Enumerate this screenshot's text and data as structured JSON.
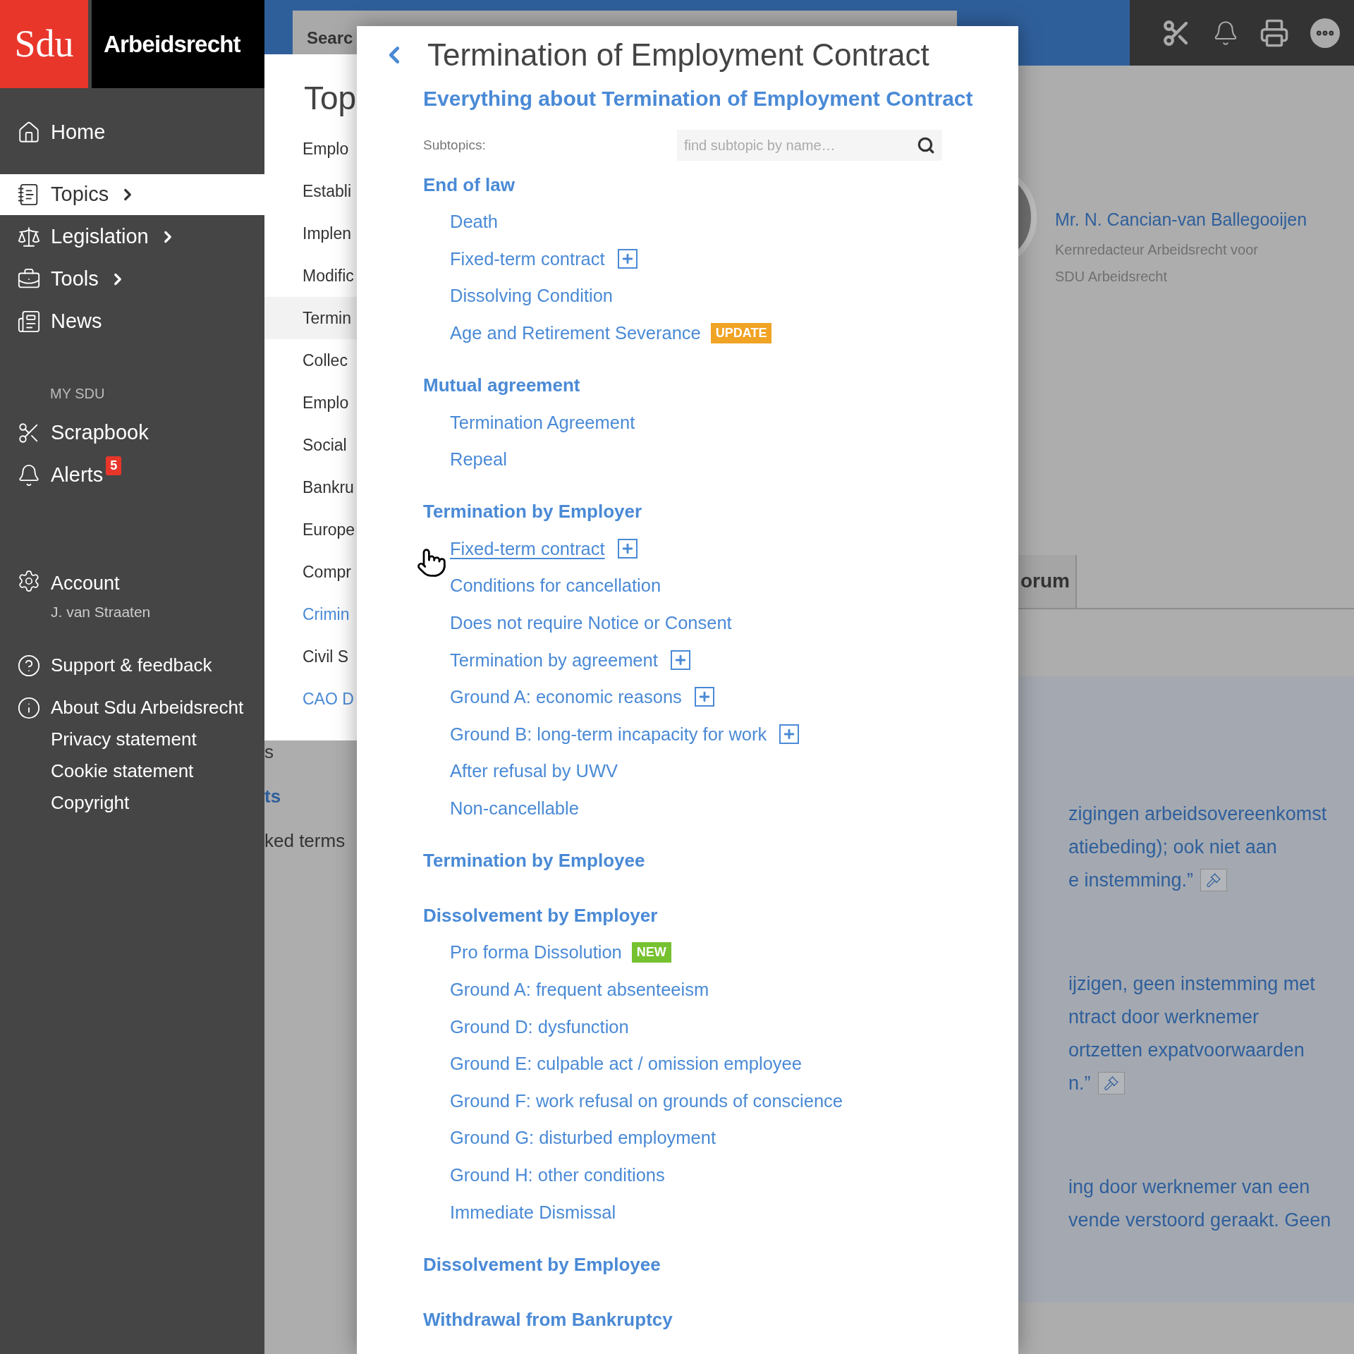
{
  "brand": {
    "logo": "Sdu",
    "title": "Arbeidsrecht"
  },
  "sidebar": {
    "items": [
      {
        "label": "Home",
        "selected": false,
        "has_arrow": false
      },
      {
        "label": "Topics",
        "selected": true,
        "has_arrow": true
      },
      {
        "label": "Legislation",
        "selected": false,
        "has_arrow": true
      },
      {
        "label": "Tools",
        "selected": false,
        "has_arrow": true
      },
      {
        "label": "News",
        "selected": false,
        "has_arrow": false
      }
    ],
    "section_title": "MY SDU",
    "my_items": [
      {
        "label": "Scrapbook"
      },
      {
        "label": "Alerts",
        "badge": "5"
      }
    ],
    "account": {
      "label": "Account",
      "user": "J. van Straaten"
    },
    "footer_links": [
      {
        "label": "Support & feedback"
      },
      {
        "label": "About Sdu Arbeidsrecht"
      },
      {
        "label": "Privacy statement"
      },
      {
        "label": "Cookie statement"
      },
      {
        "label": "Copyright"
      }
    ]
  },
  "search": {
    "placeholder": "Searc"
  },
  "background": {
    "author": {
      "name": "Mr. N. Cancian-van Ballegooijen",
      "role_lines": [
        "Kernredacteur Arbeidsrecht voor",
        "SDU Arbeidsrecht"
      ]
    },
    "tab": "orum",
    "under_panel": [
      {
        "text": "s",
        "kind": "plain"
      },
      {
        "text": "ts",
        "kind": "heading"
      },
      {
        "text": "ked terms",
        "kind": "plain"
      }
    ],
    "quote_paragraphs": [
      {
        "lines": [
          "zigingen arbeidsovereenkomst",
          "atiebeding); ook niet aan",
          "e instemming.”"
        ],
        "pin": true
      },
      {
        "lines": [
          "ijzigen, geen instemming met",
          "ntract door werknemer",
          "ortzetten expatvoorwaarden",
          "n.”"
        ],
        "pin": true
      },
      {
        "lines": [
          "ing door werknemer van een",
          "vende verstoord geraakt. Geen"
        ],
        "pin": false
      }
    ]
  },
  "topics_panel": {
    "title": "Top",
    "items": [
      {
        "label": "Emplo",
        "kind": "plain",
        "selected": false
      },
      {
        "label": "Establi",
        "kind": "plain",
        "selected": false
      },
      {
        "label": "Implen",
        "kind": "plain",
        "selected": false
      },
      {
        "label": "Modific",
        "kind": "plain",
        "selected": false
      },
      {
        "label": "Termin",
        "kind": "plain",
        "selected": true
      },
      {
        "label": "Collec",
        "kind": "plain",
        "selected": false
      },
      {
        "label": "Emplo",
        "kind": "plain",
        "selected": false
      },
      {
        "label": "Social",
        "kind": "plain",
        "selected": false
      },
      {
        "label": "Bankru",
        "kind": "plain",
        "selected": false
      },
      {
        "label": "Europe",
        "kind": "plain",
        "selected": false
      },
      {
        "label": "Compr",
        "kind": "plain",
        "selected": false
      },
      {
        "label": "Crimin",
        "kind": "link",
        "selected": false
      },
      {
        "label": "Civil S",
        "kind": "plain",
        "selected": false
      },
      {
        "label": "CAO D",
        "kind": "link",
        "selected": false
      }
    ]
  },
  "modal": {
    "title": "Termination of Employment Contract",
    "subtitle": "Everything about Termination of Employment Contract",
    "subtopics_label": "Subtopics:",
    "search_placeholder": "find subtopic by name…",
    "groups": [
      {
        "title": "End of law",
        "items": [
          {
            "label": "Death",
            "expandable": false,
            "hovered": false
          },
          {
            "label": "Fixed-term contract",
            "expandable": true,
            "hovered": false
          },
          {
            "label": "Dissolving Condition",
            "expandable": false,
            "hovered": false
          },
          {
            "label": "Age and Retirement Severance",
            "expandable": false,
            "hovered": false,
            "badge": {
              "text": "UPDATE",
              "kind": "update"
            }
          }
        ]
      },
      {
        "title": "Mutual agreement",
        "items": [
          {
            "label": "Termination Agreement",
            "expandable": false,
            "hovered": false
          },
          {
            "label": "Repeal",
            "expandable": false,
            "hovered": false
          }
        ]
      },
      {
        "title": "Termination by Employer",
        "items": [
          {
            "label": "Fixed-term contract",
            "expandable": true,
            "hovered": true
          },
          {
            "label": "Conditions for cancellation",
            "expandable": false,
            "hovered": false
          },
          {
            "label": "Does not require Notice or Consent",
            "expandable": false,
            "hovered": false
          },
          {
            "label": "Termination by agreement",
            "expandable": true,
            "hovered": false
          },
          {
            "label": "Ground A: economic reasons",
            "expandable": true,
            "hovered": false
          },
          {
            "label": "Ground B: long-term incapacity for work",
            "expandable": true,
            "hovered": false
          },
          {
            "label": "After refusal by UWV",
            "expandable": false,
            "hovered": false
          },
          {
            "label": "Non-cancellable",
            "expandable": false,
            "hovered": false
          }
        ]
      },
      {
        "title": "Termination by Employee"
      },
      {
        "title": "Dissolvement by Employer",
        "items": [
          {
            "label": "Pro forma Dissolution",
            "expandable": false,
            "hovered": false,
            "badge": {
              "text": "NEW",
              "kind": "new"
            }
          },
          {
            "label": "Ground A: frequent absenteeism",
            "expandable": false,
            "hovered": false
          },
          {
            "label": "Ground D: dysfunction",
            "expandable": false,
            "hovered": false
          },
          {
            "label": "Ground E: culpable act / omission employee",
            "expandable": false,
            "hovered": false
          },
          {
            "label": "Ground F: work refusal on grounds of conscience",
            "expandable": false,
            "hovered": false
          },
          {
            "label": "Ground G: disturbed employment",
            "expandable": false,
            "hovered": false
          },
          {
            "label": "Ground H: other conditions",
            "expandable": false,
            "hovered": false
          },
          {
            "label": "Immediate Dismissal",
            "expandable": false,
            "hovered": false
          }
        ]
      },
      {
        "title": "Dissolvement by Employee"
      },
      {
        "title": "Withdrawal from Bankruptcy"
      }
    ]
  }
}
